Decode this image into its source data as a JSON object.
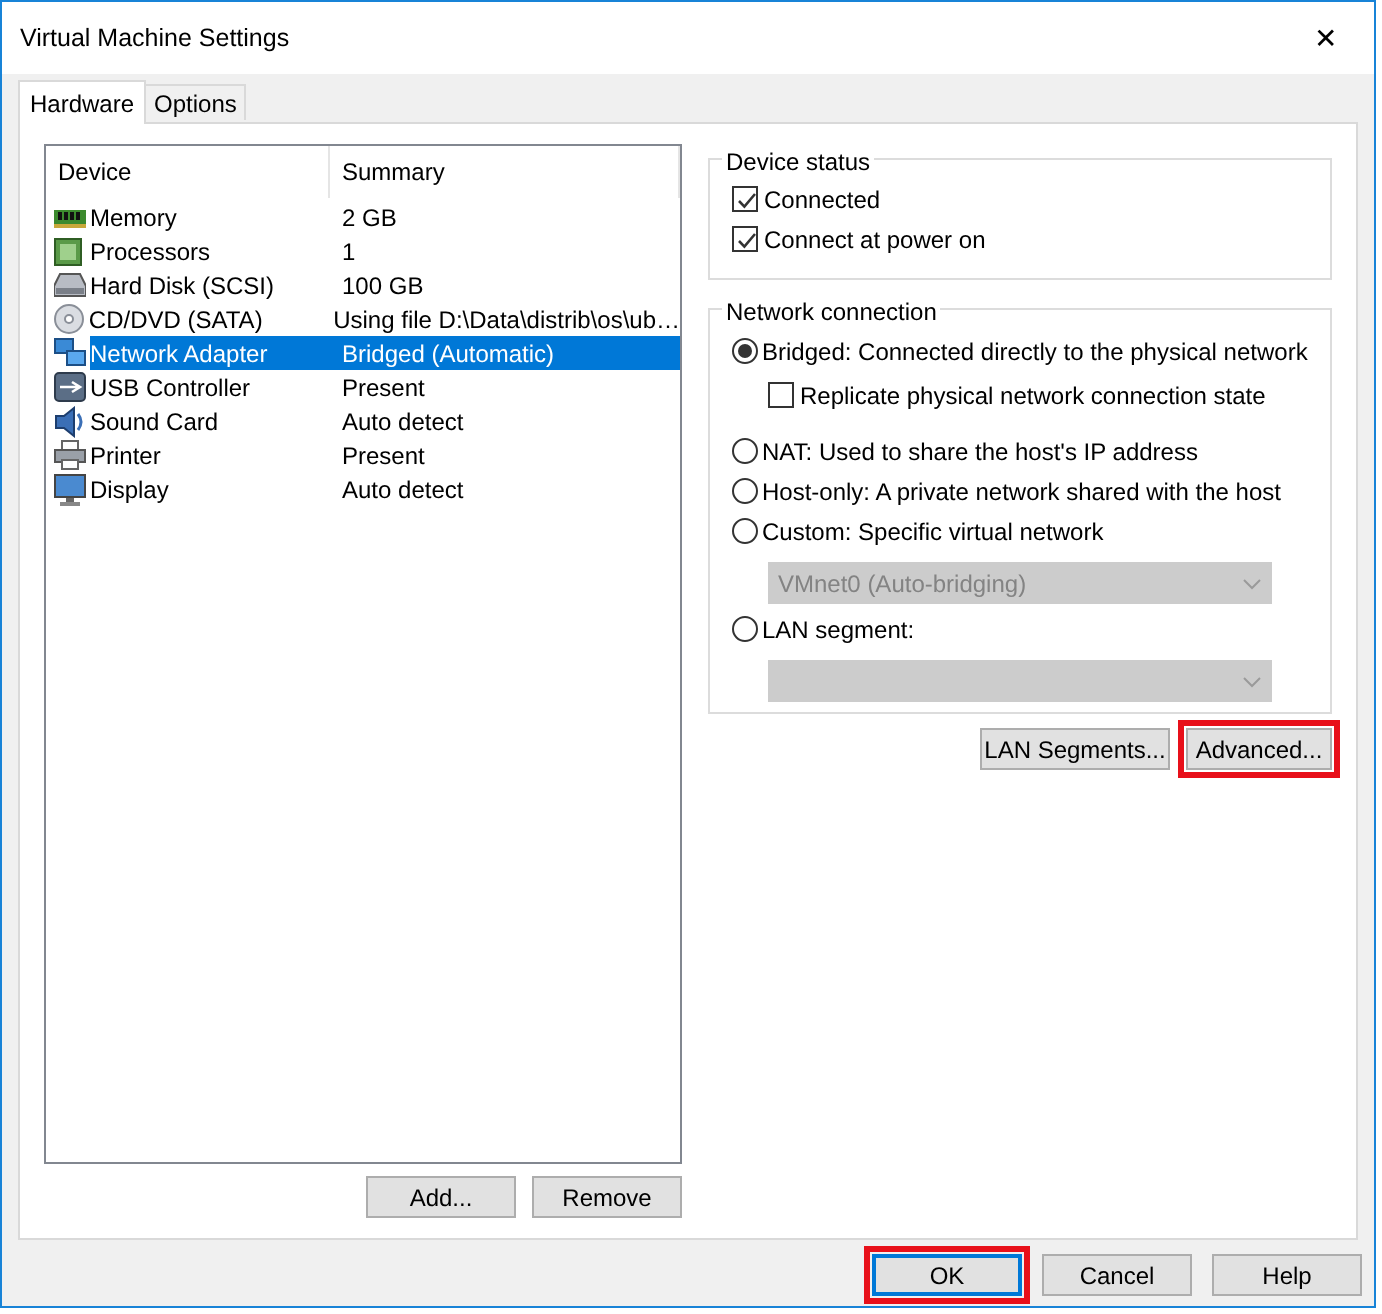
{
  "window": {
    "title": "Virtual Machine Settings",
    "close": "✕"
  },
  "tabs": [
    {
      "label": "Hardware",
      "selected": true
    },
    {
      "label": "Options",
      "selected": false
    }
  ],
  "device_table": {
    "columns": [
      "Device",
      "Summary"
    ],
    "rows": [
      {
        "kind": "memory",
        "device": "Memory",
        "summary": "2 GB",
        "selected": false
      },
      {
        "kind": "processor",
        "device": "Processors",
        "summary": "1",
        "selected": false
      },
      {
        "kind": "disk",
        "device": "Hard Disk (SCSI)",
        "summary": "100 GB",
        "selected": false
      },
      {
        "kind": "cdrom",
        "device": "CD/DVD (SATA)",
        "summary": "Using file D:\\Data\\distrib\\os\\ub…",
        "selected": false
      },
      {
        "kind": "network",
        "device": "Network Adapter",
        "summary": "Bridged (Automatic)",
        "selected": true
      },
      {
        "kind": "usb",
        "device": "USB Controller",
        "summary": "Present",
        "selected": false
      },
      {
        "kind": "sound",
        "device": "Sound Card",
        "summary": "Auto detect",
        "selected": false
      },
      {
        "kind": "printer",
        "device": "Printer",
        "summary": "Present",
        "selected": false
      },
      {
        "kind": "display",
        "device": "Display",
        "summary": "Auto detect",
        "selected": false
      }
    ]
  },
  "list_buttons": [
    {
      "label": "Add...",
      "highlighted": false
    },
    {
      "label": "Remove",
      "highlighted": false
    }
  ],
  "device_status": {
    "title": "Device status",
    "checkboxes": [
      {
        "label": "Connected",
        "checked": true
      },
      {
        "label": "Connect at power on",
        "checked": true
      }
    ]
  },
  "network_connection": {
    "title": "Network connection",
    "options": [
      {
        "label": "Bridged: Connected directly to the physical network",
        "selected": true,
        "checkbox": {
          "label": "Replicate physical network connection state",
          "checked": false
        }
      },
      {
        "label": "NAT: Used to share the host's IP address",
        "selected": false
      },
      {
        "label": "Host-only: A private network shared with the host",
        "selected": false
      },
      {
        "label": "Custom: Specific virtual network",
        "selected": false,
        "dropdown": {
          "value": "VMnet0 (Auto-bridging)",
          "disabled": true
        }
      },
      {
        "label": "LAN segment:",
        "selected": false,
        "dropdown": {
          "disabled": true
        }
      }
    ]
  },
  "network_buttons": [
    {
      "label": "LAN Segments...",
      "highlighted": false
    },
    {
      "label": "Advanced...",
      "highlighted": true
    }
  ],
  "dialog_buttons": [
    {
      "label": "OK",
      "highlighted": true,
      "default": true
    },
    {
      "label": "Cancel",
      "highlighted": false,
      "default": false
    },
    {
      "label": "Help",
      "highlighted": false,
      "default": false
    }
  ]
}
